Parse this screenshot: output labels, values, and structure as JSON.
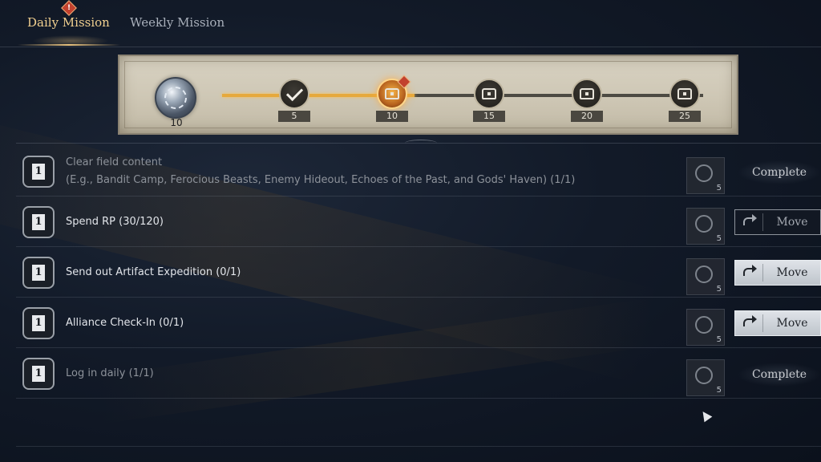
{
  "tabs": {
    "daily": "Daily Mission",
    "weekly": "Weekly Mission",
    "alert": "!"
  },
  "progress": {
    "current_points": "10",
    "filled_fraction": 0.4,
    "milestones": [
      {
        "label": "5",
        "state": "claimed",
        "icon": "check-icon"
      },
      {
        "label": "10",
        "state": "claimable",
        "icon": "chest-icon"
      },
      {
        "label": "15",
        "state": "locked",
        "icon": "chest-icon"
      },
      {
        "label": "20",
        "state": "locked",
        "icon": "chest-icon"
      },
      {
        "label": "25",
        "state": "locked",
        "icon": "chest-icon"
      }
    ]
  },
  "missions": [
    {
      "badge": "1",
      "title": "Clear field content",
      "subtitle": "(E.g., Bandit Camp, Ferocious Beasts, Enemy Hideout, Echoes of the Past, and Gods' Haven) (1/1)",
      "reward": "5",
      "action": "Complete"
    },
    {
      "badge": "1",
      "title": "Spend RP (30/120)",
      "reward": "5",
      "action": "Move"
    },
    {
      "badge": "1",
      "title": "Send out Artifact Expedition (0/1)",
      "reward": "5",
      "action": "Move"
    },
    {
      "badge": "1",
      "title": "Alliance Check-In (0/1)",
      "reward": "5",
      "action": "Move"
    },
    {
      "badge": "1",
      "title": "Log in daily (1/1)",
      "reward": "5",
      "action": "Complete"
    }
  ],
  "colors": {
    "accent": "#f0cf8f",
    "progress_fill": "#e6a93c",
    "alert": "#c2412e"
  }
}
